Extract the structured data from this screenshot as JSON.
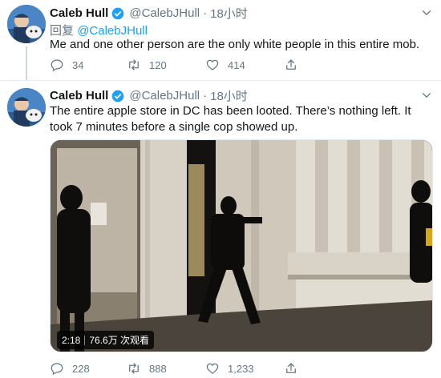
{
  "tweets": [
    {
      "name": "Caleb Hull",
      "handle": "@CalebJHull",
      "separator": "·",
      "time": "18小时",
      "reply_prefix": "回复",
      "reply_to": "@CalebJHull",
      "text": "Me and one other person are the only white people in this entire mob.",
      "replies": "34",
      "retweets": "120",
      "likes": "414"
    },
    {
      "name": "Caleb Hull",
      "handle": "@CalebJHull",
      "separator": "·",
      "time": "18小时",
      "text": "The entire apple store in DC has been looted. There’s nothing left. It took 7 minutes before a single cop showed up.",
      "video": {
        "duration": "2:18",
        "views": "76.6万 次观看"
      },
      "replies": "228",
      "retweets": "888",
      "likes": "1,233"
    }
  ],
  "colors": {
    "accent": "#1da1f2",
    "muted": "#657786",
    "text": "#14171a"
  },
  "icons": [
    "verified-icon",
    "chevron-down-icon",
    "reply-icon",
    "retweet-icon",
    "like-icon",
    "share-icon"
  ]
}
